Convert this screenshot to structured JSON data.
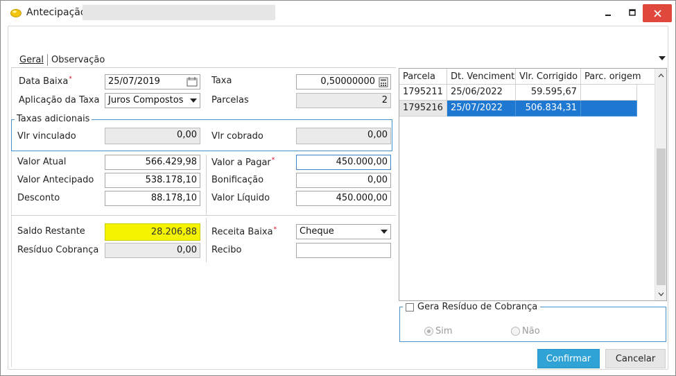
{
  "window": {
    "title": "Antecipação",
    "colors": {
      "accent": "#1e78d2",
      "close": "#e0483d",
      "highlight": "#f4f400",
      "confirm": "#2fa3d6",
      "group_border": "#4a90c8"
    }
  },
  "tabs": [
    {
      "label": "Geral"
    },
    {
      "label": "Observação"
    }
  ],
  "form": {
    "data_baixa": {
      "label": "Data Baixa",
      "value": "25/07/2019"
    },
    "taxa": {
      "label": "Taxa",
      "value": "0,50000000"
    },
    "aplicacao_taxa": {
      "label": "Aplicação da Taxa",
      "value": "Juros Compostos"
    },
    "parcelas": {
      "label": "Parcelas",
      "value": "2"
    },
    "taxas_adicionais": {
      "title": "Taxas adicionais",
      "vlr_vinculado": {
        "label": "Vlr vinculado",
        "value": "0,00"
      },
      "vlr_cobrado": {
        "label": "Vlr cobrado",
        "value": "0,00"
      }
    },
    "valor_atual": {
      "label": "Valor Atual",
      "value": "566.429,98"
    },
    "valor_a_pagar": {
      "label": "Valor a Pagar",
      "value": "450.000,00"
    },
    "valor_antecipado": {
      "label": "Valor Antecipado",
      "value": "538.178,10"
    },
    "bonificacao": {
      "label": "Bonificação",
      "value": "0,00"
    },
    "desconto": {
      "label": "Desconto",
      "value": "88.178,10"
    },
    "valor_liquido": {
      "label": "Valor Líquido",
      "value": "450.000,00"
    },
    "saldo_restante": {
      "label": "Saldo Restante",
      "value": "28.206,88"
    },
    "receita_baixa": {
      "label": "Receita Baixa",
      "value": "Cheque"
    },
    "residuo_cobranca": {
      "label": "Resíduo Cobrança",
      "value": "0,00"
    },
    "recibo": {
      "label": "Recibo",
      "value": ""
    }
  },
  "grid": {
    "columns": [
      "Parcela",
      "Dt. Vencimento",
      "Vlr. Corrigido",
      "Parc. origem"
    ],
    "rows": [
      {
        "parcela": "1795211",
        "vencimento": "25/06/2022",
        "corrigido": "59.595,67",
        "origem": ""
      },
      {
        "parcela": "1795216",
        "vencimento": "25/07/2022",
        "corrigido": "506.834,31",
        "origem": ""
      }
    ]
  },
  "residuo": {
    "title": "Gera Resíduo de Cobrança",
    "options": [
      {
        "label": "Sim"
      },
      {
        "label": "Não"
      }
    ]
  },
  "buttons": {
    "confirm": "Confirmar",
    "cancel": "Cancelar"
  }
}
